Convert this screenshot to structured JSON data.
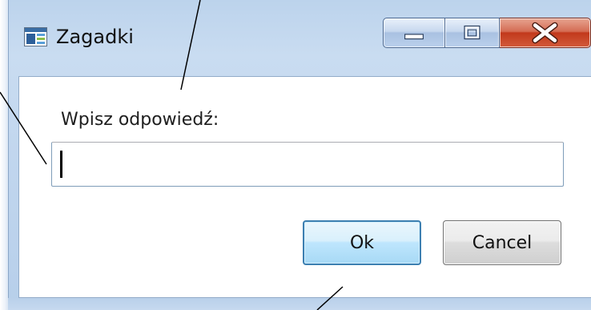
{
  "window": {
    "title": "Zagadki",
    "app_icon": "window-app-icon",
    "caption_buttons": {
      "minimize_icon": "minimize-icon",
      "maximize_icon": "maximize-icon",
      "close_icon": "close-icon"
    }
  },
  "dialog": {
    "prompt_label": "Wpisz odpowiedź:",
    "answer_value": "",
    "ok_label": "Ok",
    "cancel_label": "Cancel"
  },
  "colors": {
    "frame": "#c1d6ee",
    "close_button": "#c2391c",
    "default_button_border": "#3c7fb1"
  }
}
